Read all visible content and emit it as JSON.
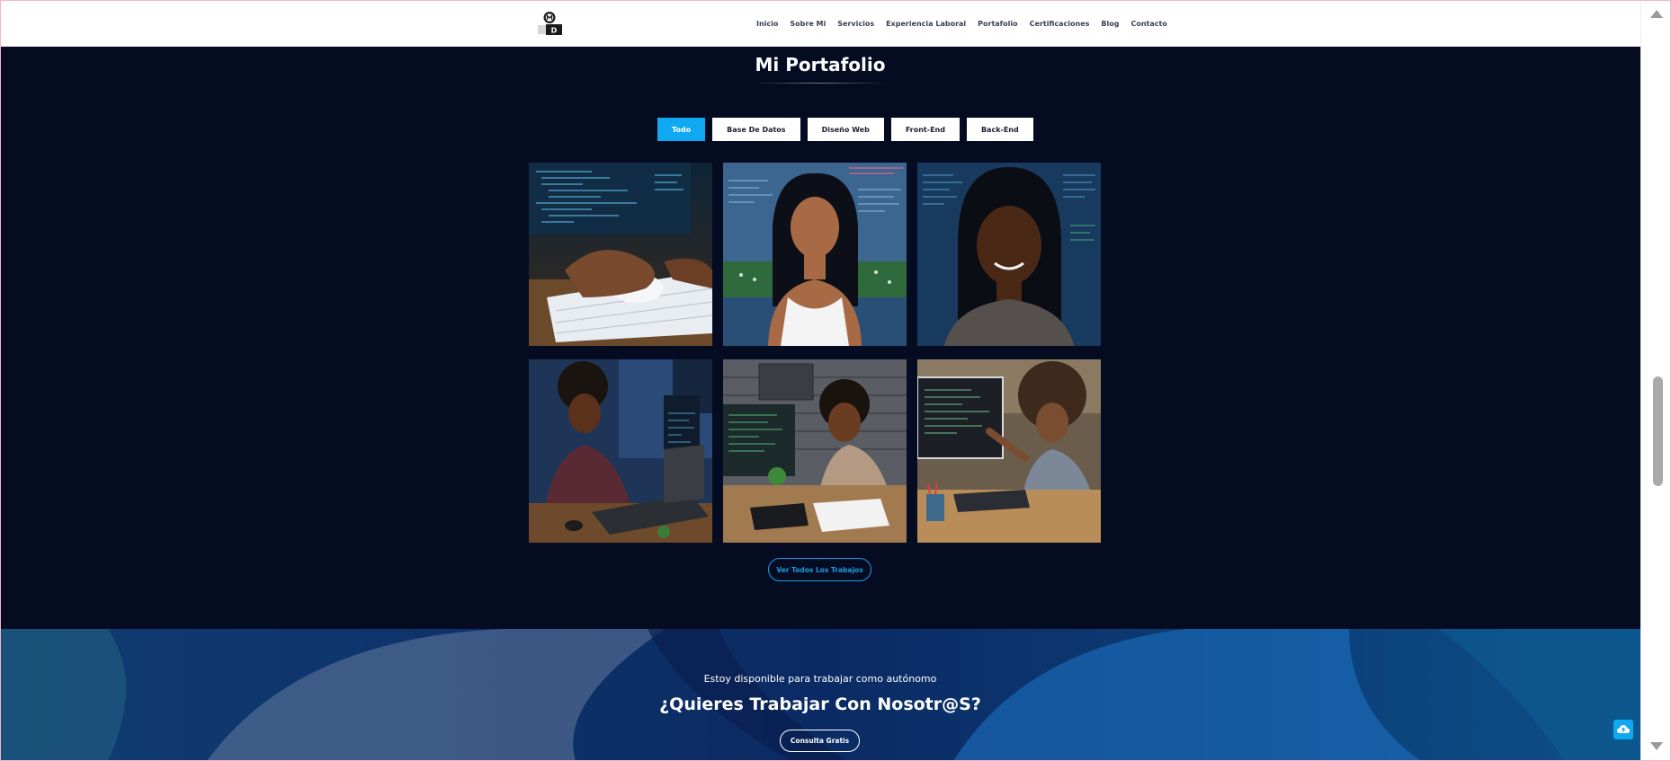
{
  "nav": {
    "items": [
      "Inicio",
      "Sobre Mi",
      "Servicios",
      "Experiencia Laboral",
      "Portafolio",
      "Certificaciones",
      "Blog",
      "Contacto"
    ]
  },
  "logo": {
    "icon": "logo-icon",
    "letter": "D"
  },
  "portfolio": {
    "title": "Mi Portafolio",
    "filters": [
      "Todo",
      "Base De Datos",
      "Diseño Web",
      "Front-End",
      "Back-End"
    ],
    "active_filter": "Todo",
    "images": [
      "hands-keyboard-mouse-image",
      "woman-code-screens-image",
      "woman-smiling-code-image",
      "woman-laptop-image",
      "woman-desk-monitor-image",
      "woman-pointing-screen-image"
    ],
    "view_all_label": "Ver Todos Los Trabajos"
  },
  "hire": {
    "subtitle": "Estoy disponible para trabajar como autónomo",
    "title": "¿Quieres Trabajar Con Nosotr@S?",
    "button_label": "Consulta Gratis"
  },
  "colors": {
    "accent": "#11a8f2",
    "portfolio_bg": "#050c22",
    "hire_bg": "#0b2a63",
    "nav_text": "#3a3f55"
  },
  "icons": {
    "back_to_top": "cloud-upload-icon",
    "scroll_up": "scroll-up-arrow-icon",
    "scroll_down": "scroll-down-arrow-icon"
  }
}
